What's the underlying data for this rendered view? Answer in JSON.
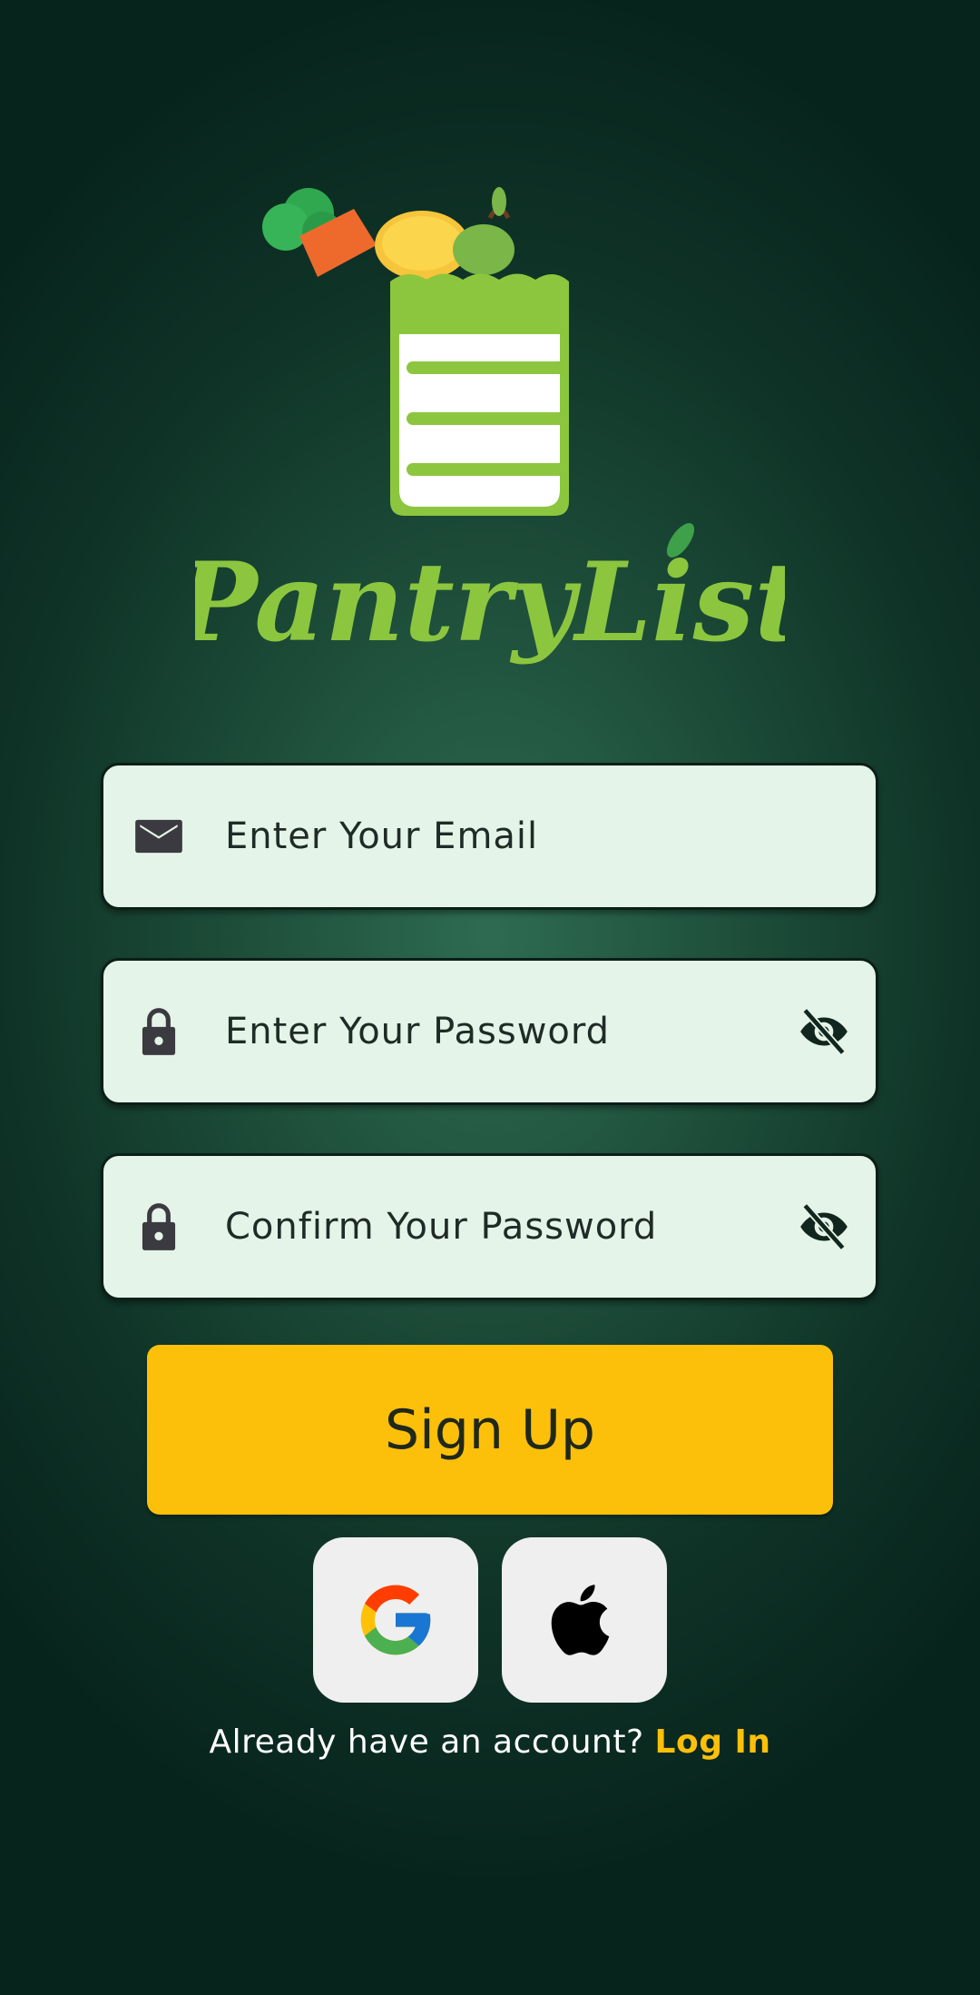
{
  "app": {
    "logo_text": "PantryList"
  },
  "form": {
    "email_placeholder": "Enter Your Email",
    "password_placeholder": "Enter Your Password",
    "confirm_placeholder": "Confirm Your Password"
  },
  "actions": {
    "signup_label": "Sign Up"
  },
  "footer": {
    "prompt": "Already have an account?",
    "login_label": "Log In"
  },
  "colors": {
    "accent": "#fcc00a",
    "field_bg": "#e5f4e8",
    "brand_green": "#8cc63f",
    "background": "#0f3327"
  },
  "icons": {
    "email": "mail-icon",
    "password": "lock-icon",
    "toggle": "eye-off-icon",
    "google": "google-icon",
    "apple": "apple-icon"
  }
}
